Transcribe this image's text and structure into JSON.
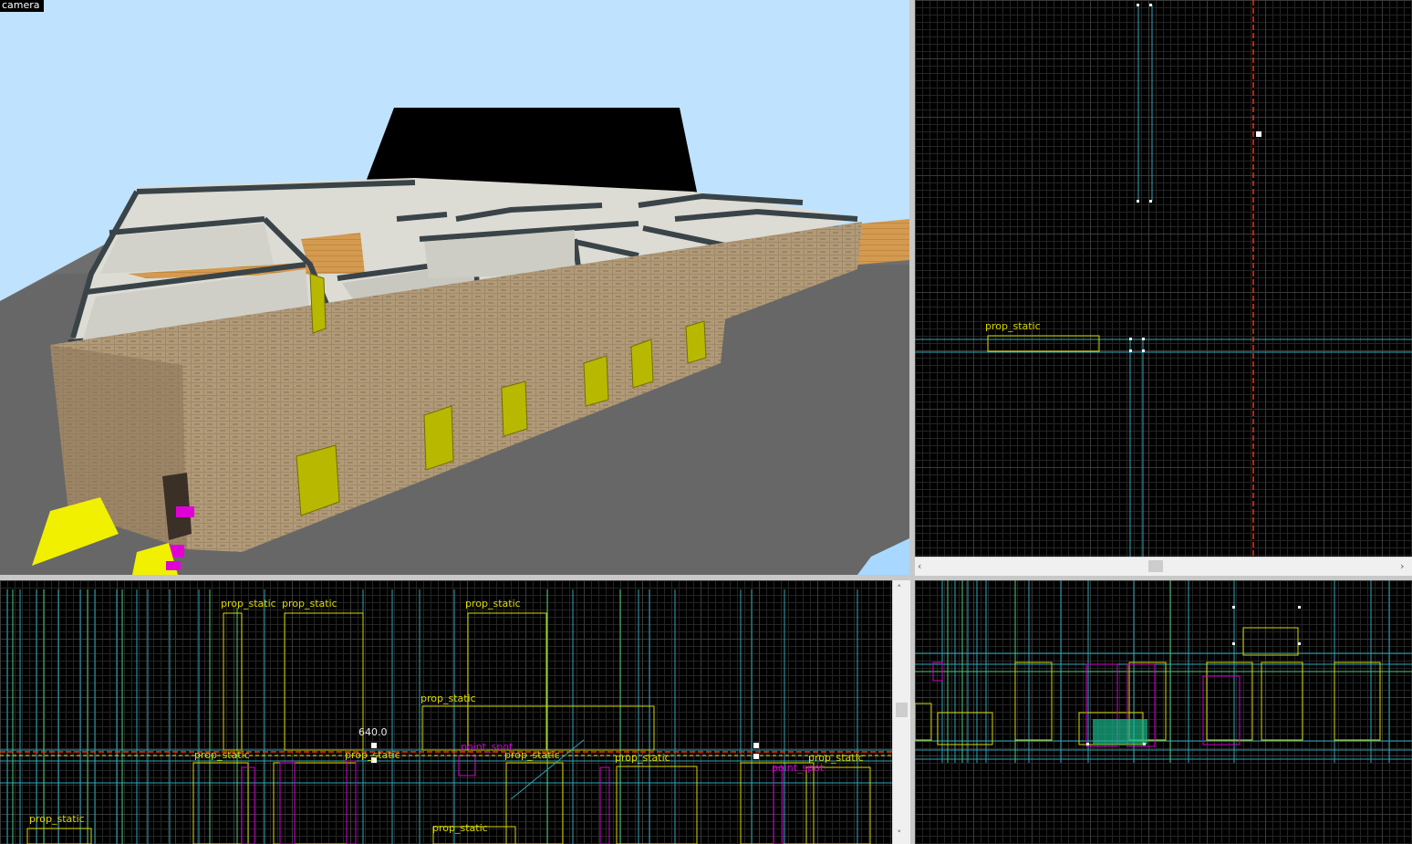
{
  "viewports": {
    "camera": {
      "label": "camera"
    },
    "top": {
      "labels": [
        "prop_static"
      ]
    },
    "front": {
      "coordinate": "640.0",
      "labels": [
        "prop_static",
        "prop_static",
        "prop_static",
        "prop_static",
        "prop_static",
        "prop_static",
        "prop_static",
        "prop_static",
        "prop_static",
        "prop_static",
        "prop_static"
      ],
      "magenta_labels": [
        "point_spot",
        "point_spot"
      ]
    }
  },
  "colors": {
    "sky": "#bfe3ff",
    "grid_bg": "#000000",
    "brush_yellow": "#d8d800",
    "brush_cyan": "#2fa6b8",
    "entity_magenta": "#d000d0",
    "selection_red": "#ff3000"
  },
  "icons": {
    "scroll_left": "chevron-left-icon",
    "scroll_right": "chevron-right-icon",
    "scroll_up": "chevron-up-icon",
    "scroll_down": "chevron-down-icon"
  }
}
